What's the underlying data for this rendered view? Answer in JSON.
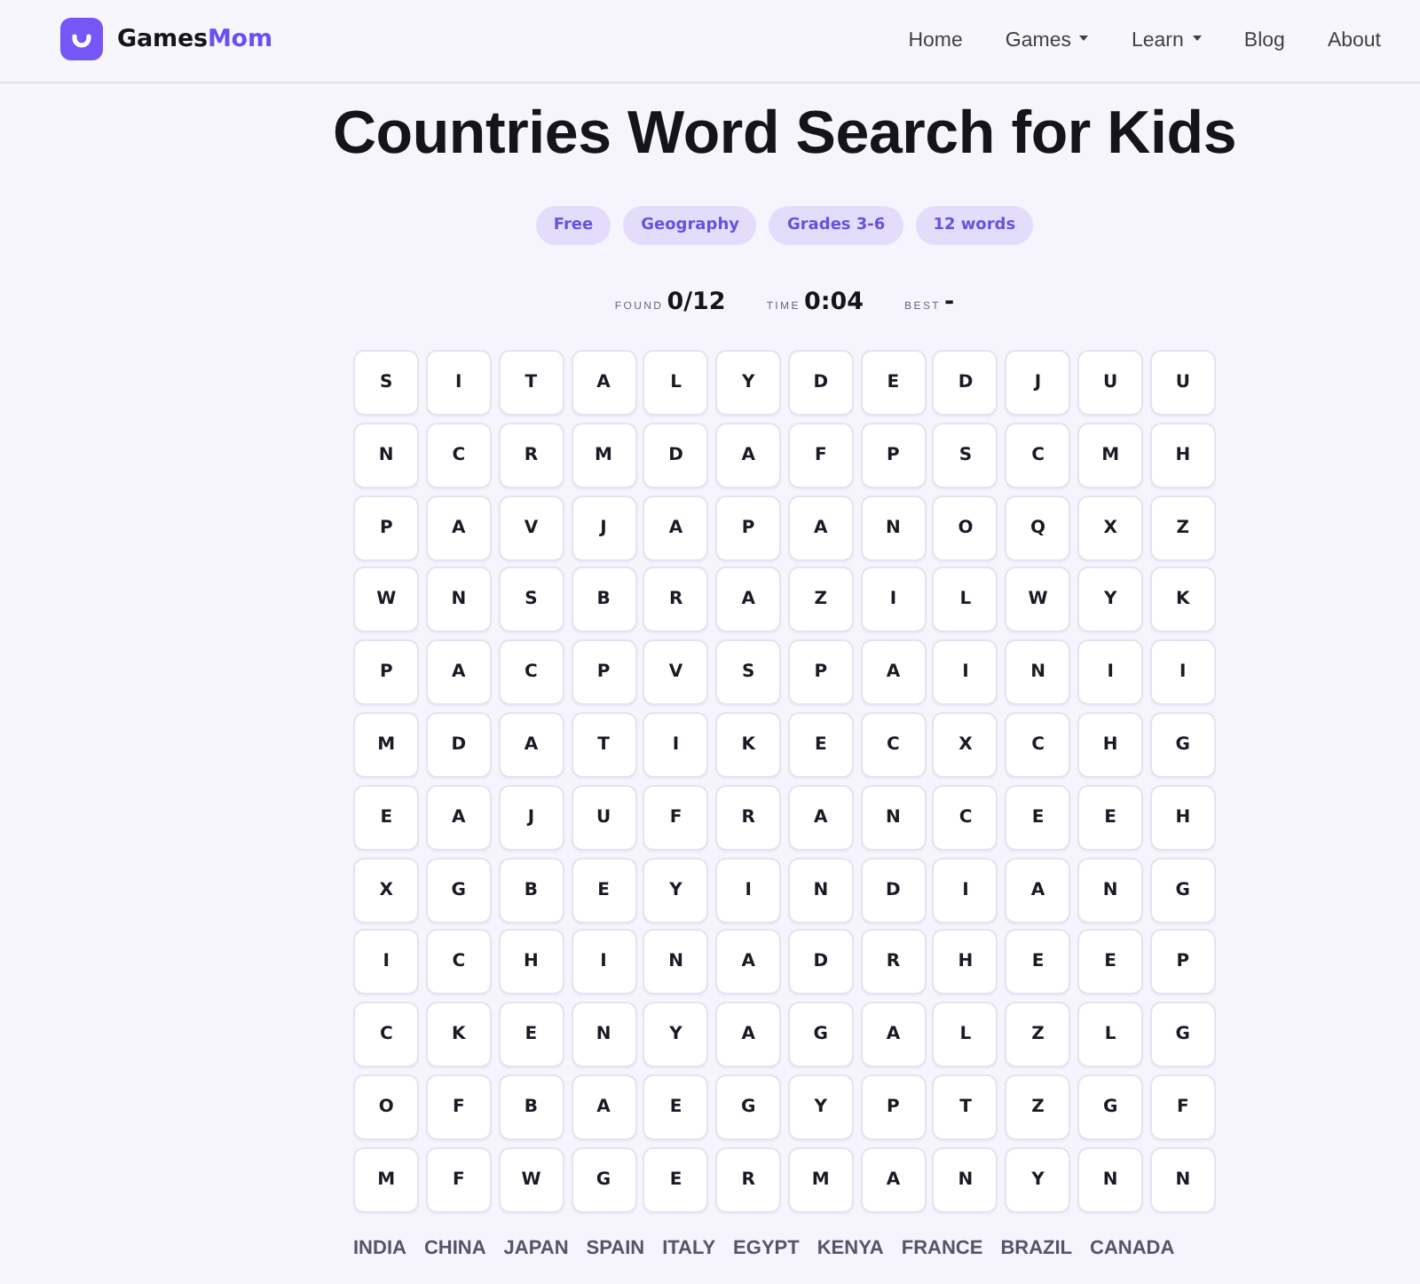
{
  "header": {
    "brand": {
      "name": "Games",
      "accent": "Mom"
    },
    "nav": [
      {
        "label": "Home",
        "has_menu": false
      },
      {
        "label": "Games",
        "has_menu": true
      },
      {
        "label": "Learn",
        "has_menu": true
      },
      {
        "label": "Blog",
        "has_menu": false
      },
      {
        "label": "About",
        "has_menu": false
      }
    ]
  },
  "title": "Countries Word Search for Kids",
  "tags": [
    "Free",
    "Geography",
    "Grades 3-6",
    "12 words"
  ],
  "stats": [
    {
      "label": "FOUND",
      "value": "0/12"
    },
    {
      "label": "TIME",
      "value": "0:04"
    },
    {
      "label": "BEST",
      "value": "-"
    }
  ],
  "grid": {
    "rows": [
      [
        "S",
        "I",
        "T",
        "A",
        "L",
        "Y",
        "D",
        "E",
        "D",
        "J",
        "U",
        "U"
      ],
      [
        "N",
        "C",
        "R",
        "M",
        "D",
        "A",
        "F",
        "P",
        "S",
        "C",
        "M",
        "H"
      ],
      [
        "P",
        "A",
        "V",
        "J",
        "A",
        "P",
        "A",
        "N",
        "O",
        "Q",
        "X",
        "Z"
      ],
      [
        "W",
        "N",
        "S",
        "B",
        "R",
        "A",
        "Z",
        "I",
        "L",
        "W",
        "Y",
        "K"
      ],
      [
        "P",
        "A",
        "C",
        "P",
        "V",
        "S",
        "P",
        "A",
        "I",
        "N",
        "I",
        "I"
      ],
      [
        "M",
        "D",
        "A",
        "T",
        "I",
        "K",
        "E",
        "C",
        "X",
        "C",
        "H",
        "G"
      ],
      [
        "E",
        "A",
        "J",
        "U",
        "F",
        "R",
        "A",
        "N",
        "C",
        "E",
        "E",
        "H"
      ],
      [
        "X",
        "G",
        "B",
        "E",
        "Y",
        "I",
        "N",
        "D",
        "I",
        "A",
        "N",
        "G"
      ],
      [
        "I",
        "C",
        "H",
        "I",
        "N",
        "A",
        "D",
        "R",
        "H",
        "E",
        "E",
        "P"
      ],
      [
        "C",
        "K",
        "E",
        "N",
        "Y",
        "A",
        "G",
        "A",
        "L",
        "Z",
        "L",
        "G"
      ],
      [
        "O",
        "F",
        "B",
        "A",
        "E",
        "G",
        "Y",
        "P",
        "T",
        "Z",
        "G",
        "F"
      ],
      [
        "M",
        "F",
        "W",
        "G",
        "E",
        "R",
        "M",
        "A",
        "N",
        "Y",
        "N",
        "N"
      ]
    ]
  },
  "words": [
    "INDIA",
    "CHINA",
    "JAPAN",
    "SPAIN",
    "ITALY",
    "EGYPT",
    "KENYA",
    "FRANCE",
    "BRAZIL",
    "CANADA"
  ]
}
